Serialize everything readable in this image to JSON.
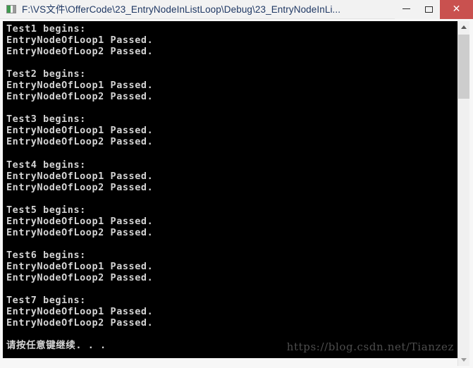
{
  "window": {
    "title": "F:\\VS文件\\OfferCode\\23_EntryNodeInListLoop\\Debug\\23_EntryNodeInLi...",
    "icon": "console-app-icon",
    "controls": {
      "minimize_label": "–",
      "maximize_label": "□",
      "close_label": "✕"
    },
    "colors": {
      "titlebar_bg": "#f2f2f2",
      "title_text": "#1f3864",
      "close_bg": "#c9514f",
      "console_bg": "#000000",
      "console_text": "#d4d4d4",
      "watermark": "#4d4d4d",
      "scrollbar_thumb": "#cdcdcd",
      "scrollbar_track": "#f0f0f0"
    }
  },
  "console": {
    "output": "Test1 begins:\nEntryNodeOfLoop1 Passed.\nEntryNodeOfLoop2 Passed.\n\nTest2 begins:\nEntryNodeOfLoop1 Passed.\nEntryNodeOfLoop2 Passed.\n\nTest3 begins:\nEntryNodeOfLoop1 Passed.\nEntryNodeOfLoop2 Passed.\n\nTest4 begins:\nEntryNodeOfLoop1 Passed.\nEntryNodeOfLoop2 Passed.\n\nTest5 begins:\nEntryNodeOfLoop1 Passed.\nEntryNodeOfLoop2 Passed.\n\nTest6 begins:\nEntryNodeOfLoop1 Passed.\nEntryNodeOfLoop2 Passed.\n\nTest7 begins:\nEntryNodeOfLoop1 Passed.\nEntryNodeOfLoop2 Passed.\n\n请按任意键继续. . .",
    "lines": [
      "Test1 begins:",
      "EntryNodeOfLoop1 Passed.",
      "EntryNodeOfLoop2 Passed.",
      "",
      "Test2 begins:",
      "EntryNodeOfLoop1 Passed.",
      "EntryNodeOfLoop2 Passed.",
      "",
      "Test3 begins:",
      "EntryNodeOfLoop1 Passed.",
      "EntryNodeOfLoop2 Passed.",
      "",
      "Test4 begins:",
      "EntryNodeOfLoop1 Passed.",
      "EntryNodeOfLoop2 Passed.",
      "",
      "Test5 begins:",
      "EntryNodeOfLoop1 Passed.",
      "EntryNodeOfLoop2 Passed.",
      "",
      "Test6 begins:",
      "EntryNodeOfLoop1 Passed.",
      "EntryNodeOfLoop2 Passed.",
      "",
      "Test7 begins:",
      "EntryNodeOfLoop1 Passed.",
      "EntryNodeOfLoop2 Passed.",
      "",
      "请按任意键继续. . ."
    ],
    "pause_prompt": "请按任意键继续. . .",
    "watermark": "https://blog.csdn.net/Tianzez"
  },
  "scrollbar": {
    "up_arrow": "chevron-up-icon",
    "down_arrow": "chevron-down-icon"
  }
}
